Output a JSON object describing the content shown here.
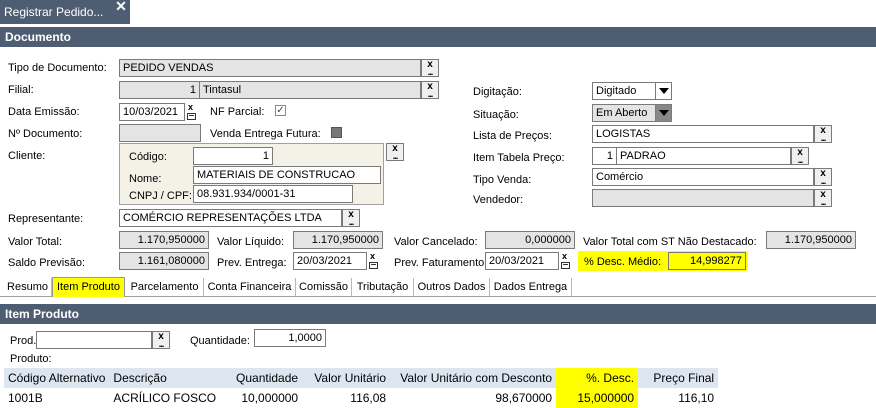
{
  "tab": {
    "title": "Registrar Pedido..."
  },
  "section_documento": "Documento",
  "documento": {
    "tipo_label": "Tipo de Documento:",
    "tipo_value": "PEDIDO VENDAS",
    "filial_label": "Filial:",
    "filial_code": "1",
    "filial_value": "Tintasul",
    "data_emissao_label": "Data Emissão:",
    "data_emissao_value": "10/03/2021",
    "nf_parcial_label": "NF Parcial:",
    "nf_parcial_mark": "✓",
    "num_documento_label": "Nº Documento:",
    "venda_entrega_label": "Venda Entrega Futura:",
    "cliente_label": "Cliente:",
    "codigo_label": "Código:",
    "codigo_value": "1",
    "nome_label": "Nome:",
    "nome_value": "MATERIAIS DE CONSTRUCAO",
    "cnpj_label": "CNPJ / CPF:",
    "cnpj_value": "08.931.934/0001-31",
    "representante_label": "Representante:",
    "representante_value": "COMÉRCIO REPRESENTAÇÕES LTDA",
    "digitacao_label": "Digitação:",
    "digitacao_value": "Digitado",
    "situacao_label": "Situação:",
    "situacao_value": "Em Aberto",
    "lista_precos_label": "Lista de Preços:",
    "lista_precos_value": "LOGISTAS",
    "item_tabela_label": "Item Tabela Preço:",
    "item_tabela_code": "1",
    "item_tabela_value": "PADRAO",
    "tipo_venda_label": "Tipo Venda:",
    "tipo_venda_value": "Comércio",
    "vendedor_label": "Vendedor:"
  },
  "totais": {
    "valor_total_label": "Valor Total:",
    "valor_total_value": "1.170,950000",
    "valor_liquido_label": "Valor Líquido:",
    "valor_liquido_value": "1.170,950000",
    "valor_cancelado_label": "Valor Cancelado:",
    "valor_cancelado_value": "0,000000",
    "valor_total_st_label": "Valor Total com ST Não Destacado:",
    "valor_total_st_value": "1.170,950000",
    "saldo_previsao_label": "Saldo Previsão:",
    "saldo_previsao_value": "1.161,080000",
    "prev_entrega_label": "Prev. Entrega:",
    "prev_entrega_value": "20/03/2021",
    "prev_faturamento_label": "Prev. Faturamento:",
    "prev_faturamento_value": "20/03/2021",
    "desc_medio_label": "% Desc. Médio:",
    "desc_medio_value": "14,998277"
  },
  "tabs": [
    "Resumo",
    "Item Produto",
    "Parcelamento",
    "Conta Financeira",
    "Comissão",
    "Tributação",
    "Outros Dados",
    "Dados Entrega"
  ],
  "section_item": "Item Produto",
  "item": {
    "prod_label": "Prod.:",
    "quantidade_label": "Quantidade:",
    "quantidade_value": "1,0000",
    "produto_label": "Produto:"
  },
  "grid": {
    "headers": [
      "Código Alternativo",
      "Descrição",
      "Quantidade",
      "Valor Unitário",
      "Valor Unitário com Desconto",
      "%. Desc.",
      "Preço Final"
    ],
    "rows": [
      [
        "1001B",
        "ACRÍLICO FOSCO",
        "10,000000",
        "116,08",
        "98,670000",
        "15,000000",
        "116,10"
      ]
    ]
  },
  "colors": {
    "header_bg": "#4f5d73",
    "highlight": "#ffff00",
    "grid_header_bg": "#dde6f0"
  }
}
